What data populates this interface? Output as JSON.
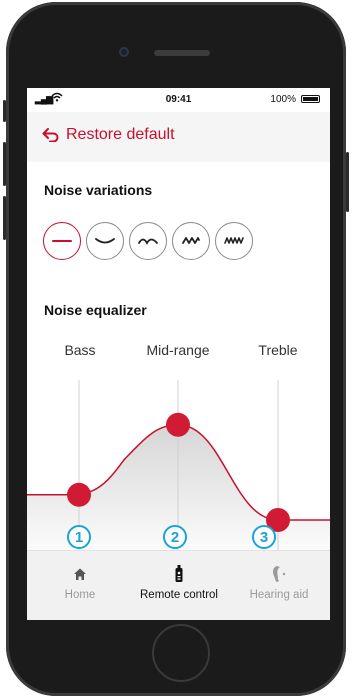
{
  "status_bar": {
    "time": "09:41",
    "battery": "100%"
  },
  "header": {
    "restore_label": "Restore default"
  },
  "noise_variations": {
    "title": "Noise variations",
    "options": [
      "flat-wave-icon",
      "low-wave-icon",
      "medium-wave-icon",
      "high-wave-icon",
      "dense-wave-icon"
    ],
    "selected_index": 0
  },
  "noise_equalizer": {
    "title": "Noise equalizer",
    "bands": [
      {
        "label": "Bass",
        "level": 0.18
      },
      {
        "label": "Mid-range",
        "level": 0.68
      },
      {
        "label": "Treble",
        "level": 0.0
      }
    ],
    "badges": [
      "1",
      "2",
      "3"
    ]
  },
  "tab_bar": {
    "tabs": [
      {
        "label": "Home",
        "icon": "home-icon",
        "active": false
      },
      {
        "label": "Remote control",
        "icon": "remote-control-icon",
        "active": true
      },
      {
        "label": "Hearing aid",
        "icon": "hearing-aid-icon",
        "active": false
      }
    ]
  },
  "colors": {
    "accent": "#c8102e",
    "badge": "#1aa3d8",
    "topbar_bg": "#f5f5f5",
    "tabbar_bg": "#f1f1f1"
  }
}
